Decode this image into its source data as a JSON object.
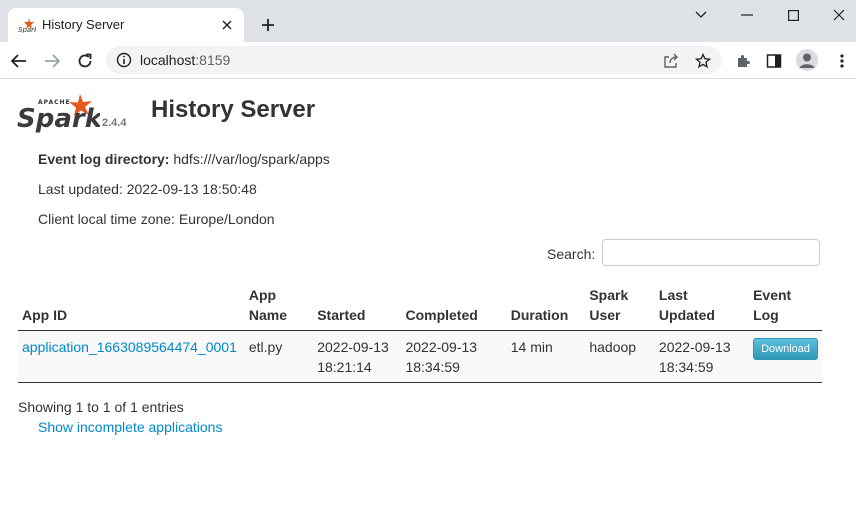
{
  "browser": {
    "tab_title": "History Server",
    "url_host": "localhost",
    "url_port": ":8159"
  },
  "header": {
    "version": "2.4.4",
    "title": "History Server"
  },
  "info": {
    "event_log_label": "Event log directory:",
    "event_log_value": "hdfs:///var/log/spark/apps",
    "last_updated": "Last updated: 2022-09-13 18:50:48",
    "timezone": "Client local time zone: Europe/London"
  },
  "search": {
    "label": "Search:",
    "value": ""
  },
  "table": {
    "headers": {
      "app_id": "App ID",
      "app_name_1": "App",
      "app_name_2": "Name",
      "started": "Started",
      "completed": "Completed",
      "duration": "Duration",
      "spark_user_1": "Spark",
      "spark_user_2": "User",
      "last_updated_1": "Last",
      "last_updated_2": "Updated",
      "event_log_1": "Event",
      "event_log_2": "Log"
    },
    "rows": [
      {
        "app_id": "application_1663089564474_0001",
        "app_name": "etl.py",
        "started_date": "2022-09-13",
        "started_time": "18:21:14",
        "completed_date": "2022-09-13",
        "completed_time": "18:34:59",
        "duration": "14 min",
        "spark_user": "hadoop",
        "last_updated_date": "2022-09-13",
        "last_updated_time": "18:34:59",
        "download_label": "Download"
      }
    ]
  },
  "footer": {
    "entries_info": "Showing 1 to 1 of 1 entries",
    "incomplete_link": "Show incomplete applications"
  },
  "colors": {
    "link": "#0088cc",
    "accent_orange": "#e25a1c",
    "button": "#2f96b4"
  }
}
